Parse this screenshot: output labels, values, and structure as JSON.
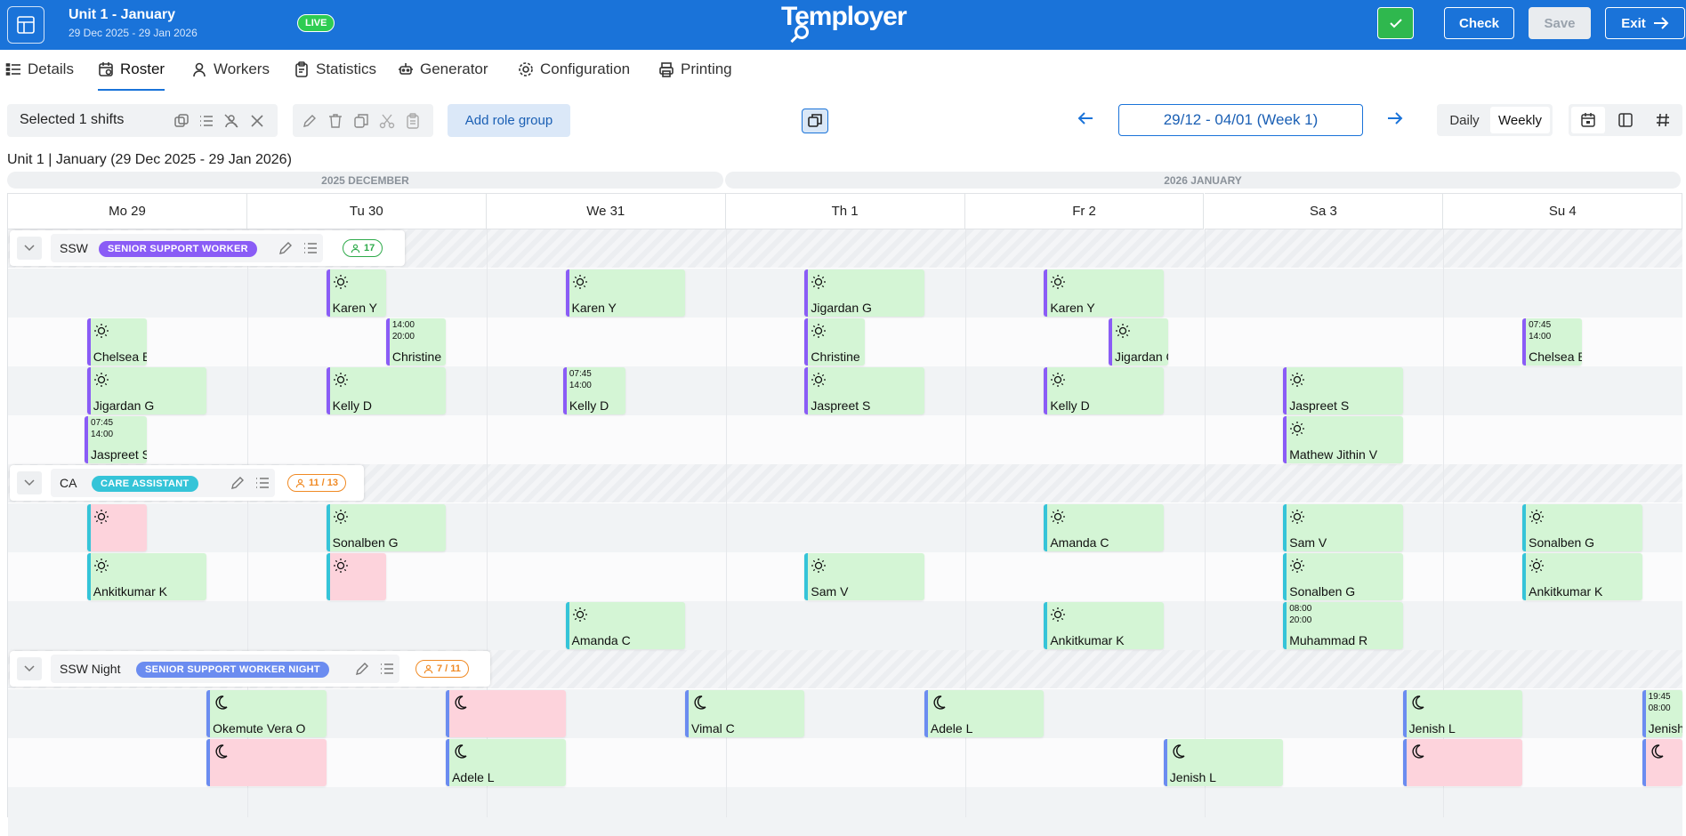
{
  "header": {
    "title": "Unit 1 - January",
    "subtitle": "29 Dec 2025 - 29 Jan 2026",
    "live_badge": "LIVE",
    "logo": "Temployer",
    "check_label": "Check",
    "save_label": "Save",
    "exit_label": "Exit"
  },
  "tabs": [
    {
      "label": "Details",
      "icon": "list-icon"
    },
    {
      "label": "Roster",
      "icon": "calendar-icon",
      "active": true
    },
    {
      "label": "Workers",
      "icon": "user-icon"
    },
    {
      "label": "Statistics",
      "icon": "clipboard-icon"
    },
    {
      "label": "Generator",
      "icon": "robot-icon"
    },
    {
      "label": "Configuration",
      "icon": "gear-icon"
    },
    {
      "label": "Printing",
      "icon": "printer-icon"
    }
  ],
  "toolbar": {
    "selected_label": "Selected 1 shifts",
    "add_role_group": "Add role group",
    "week_range": "29/12 - 04/01 (Week 1)",
    "daily": "Daily",
    "weekly": "Weekly"
  },
  "range_label": "Unit 1 | January (29 Dec 2025 - 29 Jan 2026)",
  "months": [
    "2025 DECEMBER",
    "2026 JANUARY"
  ],
  "days": [
    "Mo 29",
    "Tu 30",
    "We 31",
    "Th 1",
    "Fr 2",
    "Sa 3",
    "Su 4"
  ],
  "colors": {
    "brand": "#1a73d9",
    "live": "#2ecc52",
    "assigned": "#d4f5d5",
    "unassigned": "#fdd3dc"
  },
  "groups": [
    {
      "name": "SSW",
      "badge": "SENIOR SUPPORT WORKER",
      "badge_color": "#8a5cf6",
      "count": "17",
      "count_color": "#2eaa4a",
      "kind": "day"
    },
    {
      "name": "CA",
      "badge": "CARE ASSISTANT",
      "badge_color": "#35c4d8",
      "count": "11 / 13",
      "count_color": "#f08a24",
      "kind": "ca"
    },
    {
      "name": "SSW Night",
      "badge": "SENIOR SUPPORT WORKER NIGHT",
      "badge_color": "#6b8cf0",
      "count": "7 / 11",
      "count_color": "#f08a24",
      "kind": "night"
    }
  ],
  "shifts": [
    {
      "g": 0,
      "r": 0,
      "d": 1,
      "o": 0.33,
      "w": 0.25,
      "name": "Karen Y"
    },
    {
      "g": 0,
      "r": 0,
      "d": 2,
      "o": 0.33,
      "w": 0.5,
      "name": "Karen Y"
    },
    {
      "g": 0,
      "r": 0,
      "d": 3,
      "o": 0.33,
      "w": 0.5,
      "name": "Jigardan G"
    },
    {
      "g": 0,
      "r": 0,
      "d": 4,
      "o": 0.33,
      "w": 0.5,
      "name": "Karen Y"
    },
    {
      "g": 0,
      "r": 1,
      "d": 0,
      "o": 0.33,
      "w": 0.25,
      "name": "Chelsea B"
    },
    {
      "g": 0,
      "r": 1,
      "d": 1,
      "o": 0.58,
      "w": 0.25,
      "name": "Christine",
      "t1": "14:00",
      "t2": "20:00"
    },
    {
      "g": 0,
      "r": 1,
      "d": 3,
      "o": 0.33,
      "w": 0.25,
      "name": "Christine"
    },
    {
      "g": 0,
      "r": 1,
      "d": 4,
      "o": 0.6,
      "w": 0.25,
      "name": "Jigardan G"
    },
    {
      "g": 0,
      "r": 1,
      "d": 6,
      "o": 0.33,
      "w": 0.25,
      "name": "Chelsea B",
      "t1": "07:45",
      "t2": "14:00"
    },
    {
      "g": 0,
      "r": 2,
      "d": 0,
      "o": 0.33,
      "w": 0.5,
      "name": "Jigardan G"
    },
    {
      "g": 0,
      "r": 2,
      "d": 1,
      "o": 0.33,
      "w": 0.5,
      "name": "Kelly D"
    },
    {
      "g": 0,
      "r": 2,
      "d": 2,
      "o": 0.32,
      "w": 0.26,
      "name": "Kelly D",
      "t1": "07:45",
      "t2": "14:00"
    },
    {
      "g": 0,
      "r": 2,
      "d": 3,
      "o": 0.33,
      "w": 0.5,
      "name": "Jaspreet S"
    },
    {
      "g": 0,
      "r": 2,
      "d": 4,
      "o": 0.33,
      "w": 0.5,
      "name": "Kelly D"
    },
    {
      "g": 0,
      "r": 2,
      "d": 5,
      "o": 0.33,
      "w": 0.5,
      "name": "Jaspreet S"
    },
    {
      "g": 0,
      "r": 3,
      "d": 0,
      "o": 0.32,
      "w": 0.26,
      "name": "Jaspreet S",
      "t1": "07:45",
      "t2": "14:00"
    },
    {
      "g": 0,
      "r": 3,
      "d": 5,
      "o": 0.33,
      "w": 0.5,
      "name": "Mathew Jithin V"
    },
    {
      "g": 1,
      "r": 0,
      "d": 0,
      "o": 0.33,
      "w": 0.25,
      "name": "",
      "empty": true
    },
    {
      "g": 1,
      "r": 0,
      "d": 1,
      "o": 0.33,
      "w": 0.5,
      "name": "Sonalben G"
    },
    {
      "g": 1,
      "r": 0,
      "d": 4,
      "o": 0.33,
      "w": 0.5,
      "name": "Amanda C"
    },
    {
      "g": 1,
      "r": 0,
      "d": 5,
      "o": 0.33,
      "w": 0.5,
      "name": "Sam V"
    },
    {
      "g": 1,
      "r": 0,
      "d": 6,
      "o": 0.33,
      "w": 0.5,
      "name": "Sonalben G"
    },
    {
      "g": 1,
      "r": 1,
      "d": 0,
      "o": 0.33,
      "w": 0.5,
      "name": "Ankitkumar K"
    },
    {
      "g": 1,
      "r": 1,
      "d": 1,
      "o": 0.33,
      "w": 0.25,
      "name": "",
      "empty": true
    },
    {
      "g": 1,
      "r": 1,
      "d": 3,
      "o": 0.33,
      "w": 0.5,
      "name": "Sam V"
    },
    {
      "g": 1,
      "r": 1,
      "d": 5,
      "o": 0.33,
      "w": 0.5,
      "name": "Sonalben G"
    },
    {
      "g": 1,
      "r": 1,
      "d": 6,
      "o": 0.33,
      "w": 0.5,
      "name": "Ankitkumar K"
    },
    {
      "g": 1,
      "r": 2,
      "d": 2,
      "o": 0.33,
      "w": 0.5,
      "name": "Amanda C"
    },
    {
      "g": 1,
      "r": 2,
      "d": 4,
      "o": 0.33,
      "w": 0.5,
      "name": "Ankitkumar K"
    },
    {
      "g": 1,
      "r": 2,
      "d": 5,
      "o": 0.33,
      "w": 0.5,
      "name": "Muhammad R",
      "t1": "08:00",
      "t2": "20:00"
    },
    {
      "g": 2,
      "r": 0,
      "d": 0,
      "o": 0.83,
      "w": 0.5,
      "name": "Okemute Vera O"
    },
    {
      "g": 2,
      "r": 0,
      "d": 1,
      "o": 0.83,
      "w": 0.5,
      "name": "",
      "empty": true
    },
    {
      "g": 2,
      "r": 0,
      "d": 2,
      "o": 0.83,
      "w": 0.5,
      "name": "Vimal C"
    },
    {
      "g": 2,
      "r": 0,
      "d": 3,
      "o": 0.83,
      "w": 0.5,
      "name": "Adele L"
    },
    {
      "g": 2,
      "r": 0,
      "d": 5,
      "o": 0.83,
      "w": 0.5,
      "name": "Jenish L"
    },
    {
      "g": 2,
      "r": 0,
      "d": 6,
      "o": 0.83,
      "w": 0.17,
      "name": "Jenish L",
      "t1": "19:45",
      "t2": "08:00"
    },
    {
      "g": 2,
      "r": 1,
      "d": 0,
      "o": 0.83,
      "w": 0.5,
      "name": "",
      "empty": true
    },
    {
      "g": 2,
      "r": 1,
      "d": 1,
      "o": 0.83,
      "w": 0.5,
      "name": "Adele L"
    },
    {
      "g": 2,
      "r": 1,
      "d": 4,
      "o": 0.83,
      "w": 0.5,
      "name": "Jenish L"
    },
    {
      "g": 2,
      "r": 1,
      "d": 5,
      "o": 0.83,
      "w": 0.5,
      "name": "",
      "empty": true
    },
    {
      "g": 2,
      "r": 1,
      "d": 6,
      "o": 0.83,
      "w": 0.17,
      "name": "",
      "empty": true
    }
  ]
}
